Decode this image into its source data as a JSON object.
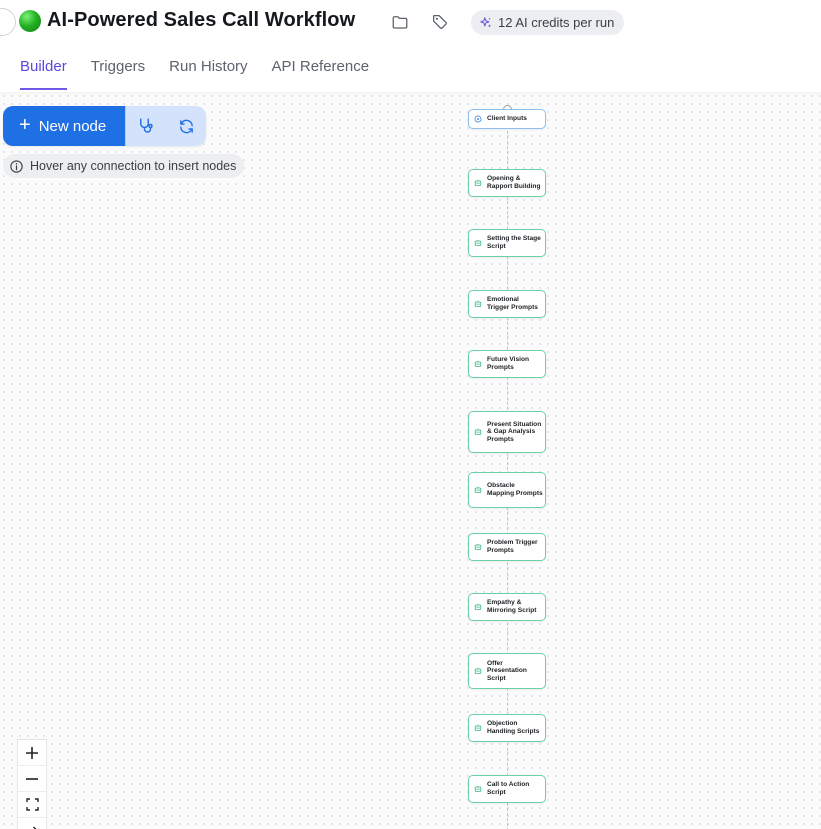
{
  "header": {
    "title": "AI-Powered Sales Call Workflow",
    "credits_label": "12 AI credits per run",
    "icons": [
      "folder-icon",
      "tag-icon",
      "sparkle-icon"
    ]
  },
  "tabs": [
    {
      "label": "Builder",
      "active": true
    },
    {
      "label": "Triggers",
      "active": false
    },
    {
      "label": "Run History",
      "active": false
    },
    {
      "label": "API Reference",
      "active": false
    }
  ],
  "toolbar": {
    "new_node_label": "New node",
    "icons": [
      "stethoscope-icon",
      "refresh-icon"
    ]
  },
  "hint": {
    "text": "Hover any connection to insert nodes",
    "icon": "info-icon"
  },
  "nodes": [
    {
      "label": "Client Inputs",
      "type": "input"
    },
    {
      "label": "Opening & Rapport Building",
      "type": "ai"
    },
    {
      "label": "Setting the Stage Script",
      "type": "ai"
    },
    {
      "label": "Emotional Trigger Prompts",
      "type": "ai"
    },
    {
      "label": "Future Vision Prompts",
      "type": "ai"
    },
    {
      "label": "Present Situation & Gap Analysis Prompts",
      "type": "ai"
    },
    {
      "label": "Obstacle Mapping Prompts",
      "type": "ai"
    },
    {
      "label": "Problem Trigger Prompts",
      "type": "ai"
    },
    {
      "label": "Empathy & Mirroring Script",
      "type": "ai"
    },
    {
      "label": "Offer Presentation Script",
      "type": "ai"
    },
    {
      "label": "Objection Handling Scripts",
      "type": "ai"
    },
    {
      "label": "Call to Action Script",
      "type": "ai"
    }
  ],
  "zoom_controls": [
    "zoom-in-icon",
    "zoom-out-icon",
    "fit-view-icon",
    "arrow-icon"
  ],
  "colors": {
    "accent": "#5b47e0",
    "primary_button": "#1f6fe5",
    "node_border": "#6bd1a4"
  }
}
